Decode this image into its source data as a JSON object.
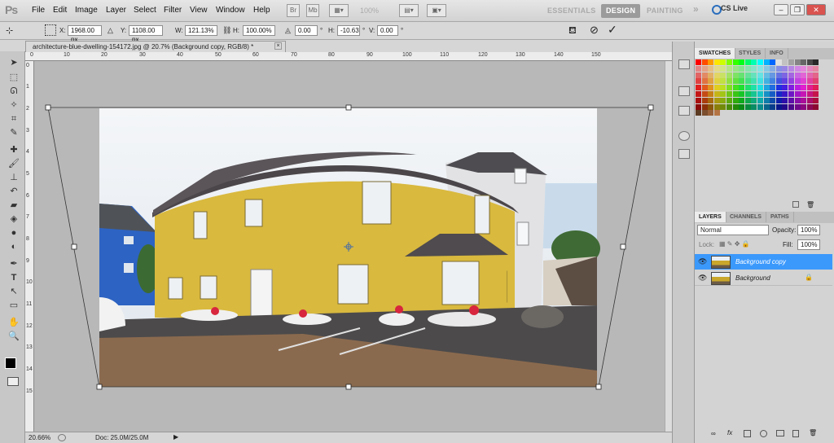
{
  "app": {
    "logo": "Ps"
  },
  "menu": [
    "File",
    "Edit",
    "Image",
    "Layer",
    "Select",
    "Filter",
    "View",
    "Window",
    "Help"
  ],
  "appbar": {
    "br": "Br",
    "mb": "Mb",
    "zoom": "100%"
  },
  "workspaces": {
    "essentials": "ESSENTIALS",
    "design": "DESIGN",
    "painting": "PAINTING",
    "more": "»"
  },
  "cslive": "CS Live",
  "options": {
    "x_label": "X:",
    "x": "1968.00 px",
    "y_label": "Y:",
    "y": "1108.00 px",
    "w_label": "W:",
    "w": "121.13%",
    "h_label": "H:",
    "h": "100.00%",
    "rot": "0.00",
    "deg1": "°",
    "hskew_label": "H:",
    "hskew": "-10.63",
    "deg2": "°",
    "vskew_label": "V:",
    "vskew": "0.00",
    "deg3": "°"
  },
  "document": {
    "tab_title": "architecture-blue-dwelling-154172.jpg @ 20.7% (Background copy, RGB/8) *",
    "close": "×"
  },
  "ruler_h": [
    "0",
    "10",
    "20",
    "30",
    "40",
    "50",
    "60",
    "70",
    "80",
    "90",
    "100",
    "110",
    "120",
    "130",
    "140",
    "150"
  ],
  "ruler_v": [
    "0",
    "1",
    "2",
    "3",
    "4",
    "5",
    "6",
    "7",
    "8",
    "9",
    "10",
    "11",
    "12",
    "13",
    "14",
    "15"
  ],
  "status": {
    "zoom": "20.66%",
    "doc": "Doc: 25.0M/25.0M"
  },
  "panels": {
    "tabs_top": [
      "SWATCHES",
      "STYLES",
      "INFO"
    ],
    "tabs_layers": [
      "LAYERS",
      "CHANNELS",
      "PATHS"
    ],
    "blend_mode": "Normal",
    "opacity_label": "Opacity:",
    "opacity": "100%",
    "lock_label": "Lock:",
    "fill_label": "Fill:",
    "fill": "100%",
    "layers": [
      {
        "name": "Background copy"
      },
      {
        "name": "Background"
      }
    ]
  },
  "colors": {
    "accent": "#3b99fc",
    "wall": "#d9b93e"
  }
}
